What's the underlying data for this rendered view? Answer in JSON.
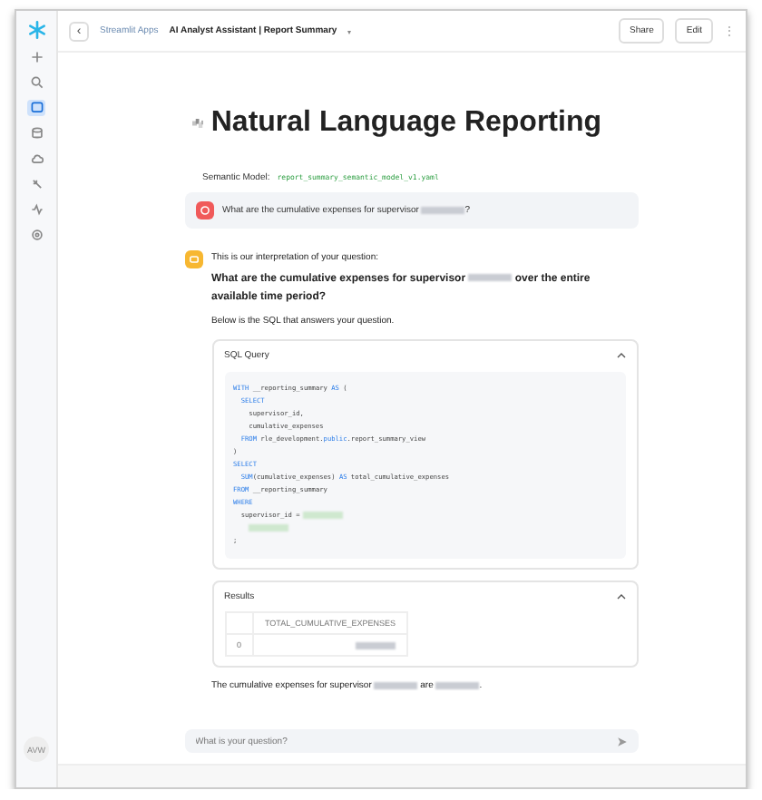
{
  "sidebar": {
    "items": [
      {
        "kind": "plus",
        "selected": false
      },
      {
        "kind": "search",
        "selected": false
      },
      {
        "kind": "chat",
        "selected": true
      },
      {
        "kind": "database",
        "selected": false
      },
      {
        "kind": "cloud",
        "selected": false
      },
      {
        "kind": "wand",
        "selected": false
      },
      {
        "kind": "activity",
        "selected": false
      },
      {
        "kind": "gear",
        "selected": false
      }
    ],
    "avatar": "AVW"
  },
  "topbar": {
    "back": "‹",
    "breadcrumb": "Streamlit Apps",
    "app_title": "AI Analyst Assistant | Report Summary",
    "caret": "▾",
    "buttons": [
      "Share",
      "Edit"
    ],
    "more": "⋮"
  },
  "title": "Natural Language Reporting",
  "semantic_model": {
    "label": "Semantic Model:",
    "value": "report_summary_semantic_model_v1.yaml"
  },
  "user_message": {
    "parts": [
      {
        "kind": "text",
        "text": "What are the cumulative expenses for supervisor "
      },
      {
        "kind": "redacted"
      },
      {
        "kind": "text",
        "text": "?"
      }
    ]
  },
  "assistant": {
    "intro": "This is our interpretation of your question:",
    "question": [
      {
        "kind": "text",
        "text": "What are the cumulative expenses for supervisor "
      },
      {
        "kind": "redacted"
      },
      {
        "kind": "text",
        "text": " over the entire available time period?"
      }
    ],
    "sql_intro": "Below is the SQL that answers your question.",
    "sql_panel": {
      "title": "SQL Query",
      "expanded": true,
      "lines": [
        [
          {
            "kind": "keyword",
            "text": "WITH"
          },
          {
            "kind": "plain",
            "text": " __reporting_summary "
          },
          {
            "kind": "keyword",
            "text": "AS"
          },
          {
            "kind": "plain",
            "text": " ("
          }
        ],
        [
          {
            "kind": "keyword",
            "text": "  SELECT"
          }
        ],
        [
          {
            "kind": "plain",
            "text": "    supervisor_id,"
          }
        ],
        [
          {
            "kind": "plain",
            "text": "    cumulative_expenses"
          }
        ],
        [
          {
            "kind": "keyword",
            "text": "  FROM"
          },
          {
            "kind": "plain",
            "text": " rle_development."
          },
          {
            "kind": "keyword",
            "text": "public"
          },
          {
            "kind": "plain",
            "text": ".report_summary_view"
          }
        ],
        [
          {
            "kind": "plain",
            "text": ")"
          }
        ],
        [
          {
            "kind": "keyword",
            "text": "SELECT"
          }
        ],
        [
          {
            "kind": "keyword",
            "text": "  SUM"
          },
          {
            "kind": "plain",
            "text": "(cumulative_expenses) "
          },
          {
            "kind": "keyword",
            "text": "AS"
          },
          {
            "kind": "plain",
            "text": " total_cumulative_expenses"
          }
        ],
        [
          {
            "kind": "keyword",
            "text": "FROM"
          },
          {
            "kind": "plain",
            "text": " __reporting_summary"
          }
        ],
        [
          {
            "kind": "keyword",
            "text": "WHERE"
          }
        ],
        [
          {
            "kind": "plain",
            "text": "  supervisor_id = "
          },
          {
            "kind": "redacted"
          }
        ],
        [
          {
            "kind": "redacted"
          }
        ],
        [
          {
            "kind": "plain",
            "text": ";"
          }
        ]
      ]
    },
    "results_panel": {
      "title": "Results",
      "expanded": true,
      "columns": [
        "TOTAL_CUMULATIVE_EXPENSES"
      ],
      "rows": [
        {
          "index": "0"
        }
      ]
    },
    "summary": [
      {
        "kind": "text",
        "text": "The cumulative expenses for supervisor "
      },
      {
        "kind": "redacted"
      },
      {
        "kind": "text",
        "text": " are "
      },
      {
        "kind": "redacted"
      },
      {
        "kind": "text",
        "text": "."
      }
    ]
  },
  "input": {
    "placeholder": "What is your question?"
  }
}
